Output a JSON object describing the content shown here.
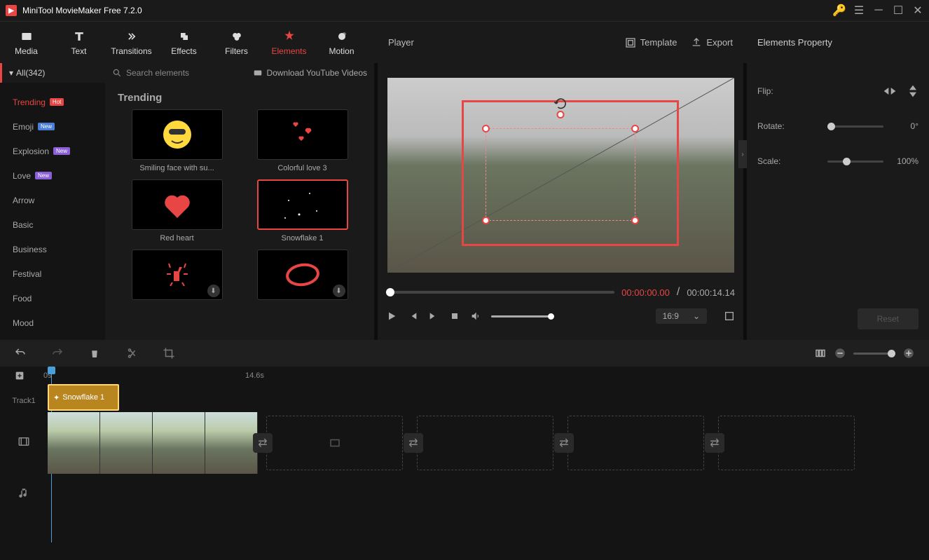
{
  "app_title": "MiniTool MovieMaker Free 7.2.0",
  "tabs": {
    "media": "Media",
    "text": "Text",
    "transitions": "Transitions",
    "effects": "Effects",
    "filters": "Filters",
    "elements": "Elements",
    "motion": "Motion"
  },
  "player": {
    "label": "Player",
    "template": "Template",
    "export": "Export"
  },
  "props": {
    "title": "Elements Property",
    "flip": "Flip:",
    "rotate": "Rotate:",
    "scale": "Scale:",
    "rotate_val": "0°",
    "scale_val": "100%",
    "reset": "Reset"
  },
  "sidebar": {
    "all": "All(342)",
    "items": [
      {
        "label": "Trending",
        "badge": "Hot",
        "bc": "b-hot",
        "sel": true
      },
      {
        "label": "Emoji",
        "badge": "New",
        "bc": "b-new"
      },
      {
        "label": "Explosion",
        "badge": "New",
        "bc": "b-new2"
      },
      {
        "label": "Love",
        "badge": "New",
        "bc": "b-new2"
      },
      {
        "label": "Arrow"
      },
      {
        "label": "Basic"
      },
      {
        "label": "Business"
      },
      {
        "label": "Festival"
      },
      {
        "label": "Food"
      },
      {
        "label": "Mood"
      }
    ]
  },
  "search_placeholder": "Search elements",
  "download_link": "Download YouTube Videos",
  "section": "Trending",
  "elements": [
    {
      "label": "Smiling face with su...",
      "sel": false,
      "dl": false,
      "icon": "emoji"
    },
    {
      "label": "Colorful love 3",
      "sel": false,
      "dl": false,
      "icon": "hearts"
    },
    {
      "label": "Red heart",
      "sel": false,
      "dl": false,
      "icon": "heart"
    },
    {
      "label": "Snowflake 1",
      "sel": true,
      "dl": false,
      "icon": "snow"
    },
    {
      "label": "",
      "sel": false,
      "dl": true,
      "icon": "thumbs"
    },
    {
      "label": "",
      "sel": false,
      "dl": true,
      "icon": "circle"
    }
  ],
  "time": {
    "current": "00:00:00.00",
    "total": "00:00:14.14"
  },
  "aspect": "16:9",
  "ruler": {
    "t0": "0s",
    "t1": "14.6s"
  },
  "track1": "Track1",
  "clip_name": "Snowflake 1"
}
